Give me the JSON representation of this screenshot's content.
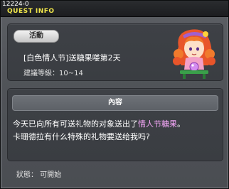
{
  "window": {
    "id": "12224-0",
    "title": "QUEST INFO"
  },
  "quest": {
    "category": "活動",
    "name": "[白色情人节]送糖果喽第2天",
    "level": "建議等級：10~14",
    "npc_icon": "npc-girl-portrait-icon"
  },
  "content": {
    "header": "內容",
    "line1_prefix": "今天已向所有可送礼物的对象送出了",
    "line1_highlight": "情人节糖果",
    "line1_suffix": "。",
    "line2": "卡珊德拉有什么特殊的礼物要送给我吗?"
  },
  "status": "狀態： 可開始",
  "colors": {
    "title": "#f2e84a",
    "highlight": "#f3a6f6",
    "panel": "#3c3f44"
  }
}
